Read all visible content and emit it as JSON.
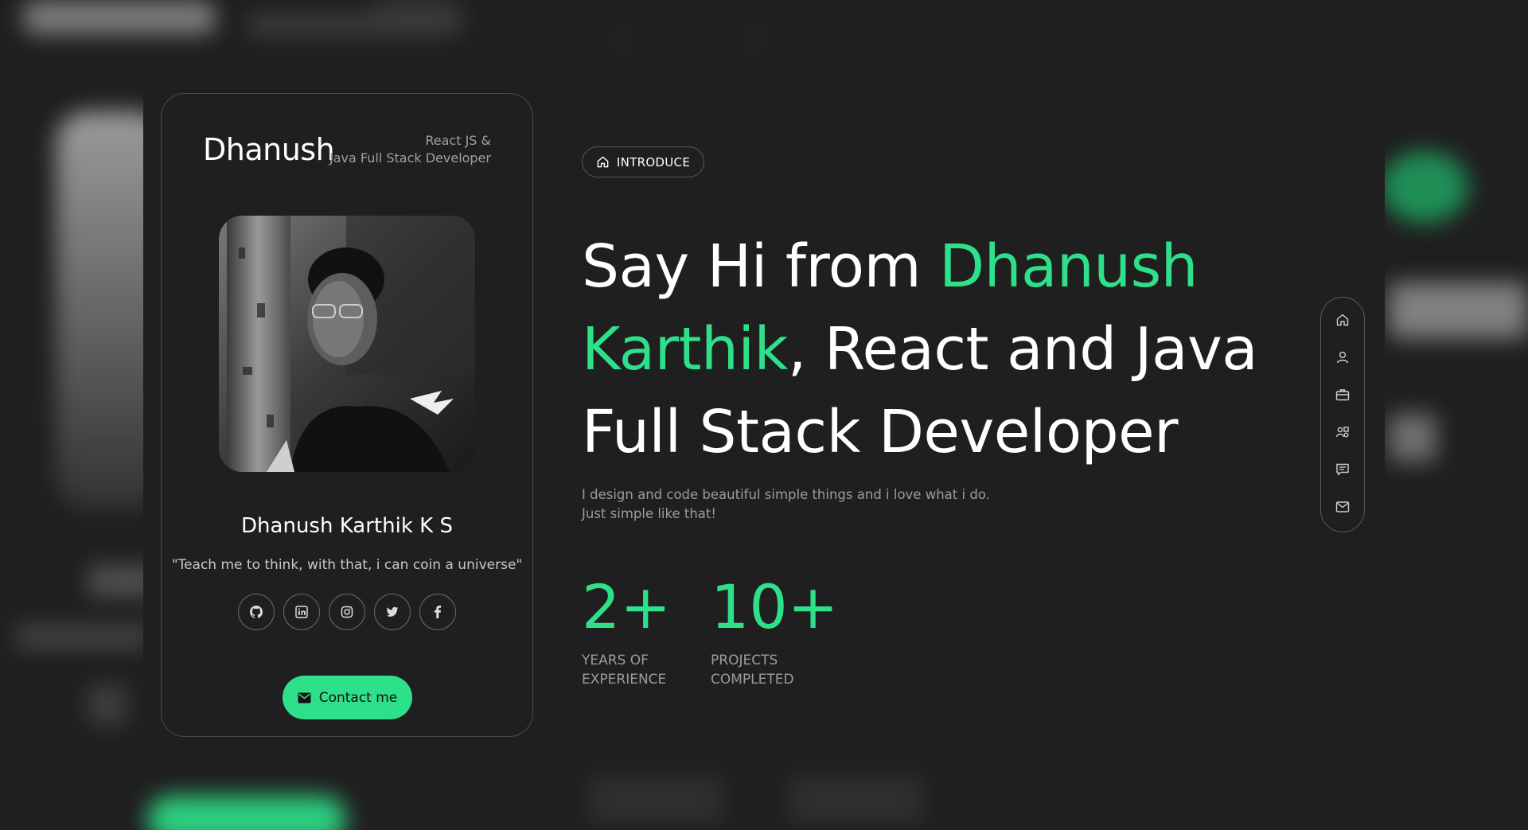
{
  "card": {
    "name": "Dhanush",
    "role_line1": "React JS &",
    "role_line2": "Java Full Stack Developer",
    "full_name": "Dhanush Karthik K S",
    "quote": "\"Teach me to think, with that, i can coin a universe\"",
    "social": [
      {
        "name": "github-icon"
      },
      {
        "name": "linkedin-icon"
      },
      {
        "name": "instagram-icon"
      },
      {
        "name": "twitter-icon"
      },
      {
        "name": "facebook-icon"
      }
    ],
    "contact_label": "Contact me"
  },
  "intro": {
    "pill_label": "INTRODUCE",
    "headline_part1": "Say Hi from ",
    "headline_accent": "Dhanush Karthik",
    "headline_part2": ", React and Java Full Stack Developer",
    "desc_line1": "I design and code beautiful simple things and i love what i do.",
    "desc_line2": "Just simple like that!"
  },
  "stats": [
    {
      "value": "2+",
      "label_line1": "YEARS OF",
      "label_line2": "EXPERIENCE"
    },
    {
      "value": "10+",
      "label_line1": "PROJECTS",
      "label_line2": "COMPLETED"
    }
  ],
  "side_nav": [
    "home-icon",
    "user-icon",
    "briefcase-icon",
    "services-icon",
    "message-icon",
    "mail-icon"
  ],
  "colors": {
    "accent": "#2fe08a",
    "background": "#1f1f1f",
    "muted_text": "#9c9c9c",
    "border": "#4a4a4a"
  }
}
